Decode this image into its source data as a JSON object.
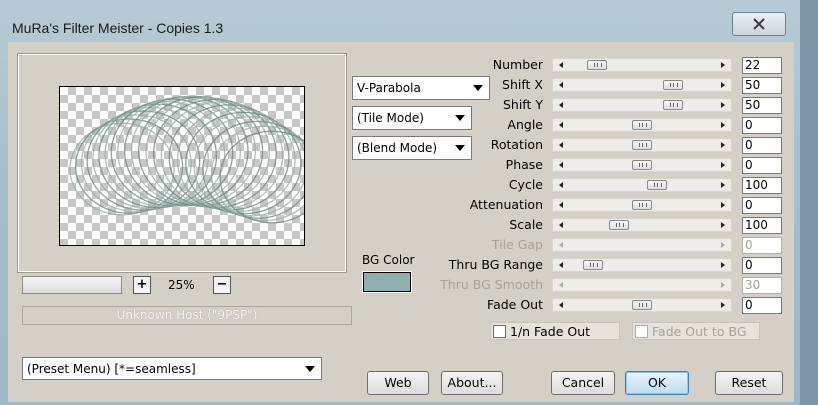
{
  "window": {
    "title": "MuRa's Filter Meister - Copies 1.3"
  },
  "preview": {
    "zoom": "25%",
    "host_text": "Unknown Host (\"9PSP\")"
  },
  "modes": {
    "shape": "V-Parabola",
    "tile": "(Tile Mode)",
    "blend": "(Blend Mode)"
  },
  "bg_color": {
    "label": "BG Color",
    "value": "#8fb0ac"
  },
  "params": [
    {
      "label": "Number",
      "value": "22",
      "position": 0.15,
      "enabled": true
    },
    {
      "label": "Shift X",
      "value": "50",
      "position": 0.74,
      "enabled": true
    },
    {
      "label": "Shift Y",
      "value": "50",
      "position": 0.74,
      "enabled": true
    },
    {
      "label": "Angle",
      "value": "0",
      "position": 0.5,
      "enabled": true
    },
    {
      "label": "Rotation",
      "value": "0",
      "position": 0.5,
      "enabled": true
    },
    {
      "label": "Phase",
      "value": "0",
      "position": 0.5,
      "enabled": true
    },
    {
      "label": "Cycle",
      "value": "100",
      "position": 0.62,
      "enabled": true
    },
    {
      "label": "Attenuation",
      "value": "0",
      "position": 0.5,
      "enabled": true
    },
    {
      "label": "Scale",
      "value": "100",
      "position": 0.32,
      "enabled": true
    },
    {
      "label": "Tile Gap",
      "value": "0",
      "position": null,
      "enabled": false
    },
    {
      "label": "Thru BG Range",
      "value": "0",
      "position": 0.12,
      "enabled": true
    },
    {
      "label": "Thru BG Smooth",
      "value": "30",
      "position": null,
      "enabled": false
    },
    {
      "label": "Fade Out",
      "value": "0",
      "position": 0.5,
      "enabled": true
    }
  ],
  "checkboxes": {
    "fade_1n": {
      "label": "1/n Fade Out",
      "checked": false,
      "enabled": true
    },
    "fade_bg": {
      "label": "Fade Out to BG",
      "checked": false,
      "enabled": false
    }
  },
  "preset_menu": "(Preset Menu)  [*=seamless]",
  "buttons": {
    "web": "Web",
    "about": "About...",
    "cancel": "Cancel",
    "ok": "OK",
    "reset": "Reset"
  }
}
